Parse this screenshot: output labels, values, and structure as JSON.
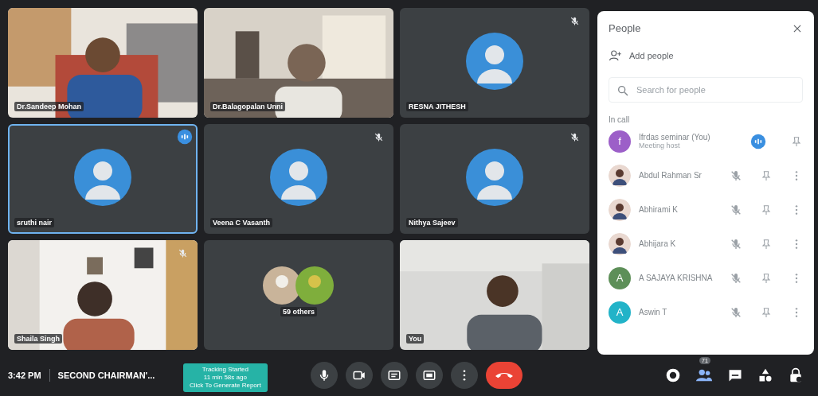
{
  "tiles": [
    {
      "name": "Dr.Sandeep Mohan",
      "kind": "video",
      "muted": false,
      "speaking": false
    },
    {
      "name": "Dr.Balagopalan Unni",
      "kind": "video",
      "muted": false,
      "speaking": false
    },
    {
      "name": "RESNA JITHESH",
      "kind": "avatar",
      "muted": true,
      "speaking": false
    },
    {
      "name": "sruthi nair",
      "kind": "avatar",
      "muted": false,
      "speaking": true
    },
    {
      "name": "Veena C Vasanth",
      "kind": "avatar",
      "muted": true,
      "speaking": false
    },
    {
      "name": "Nithya Sajeev",
      "kind": "avatar",
      "muted": true,
      "speaking": false
    },
    {
      "name": "Shaila Singh",
      "kind": "video",
      "muted": true,
      "speaking": false
    },
    {
      "name": "59 others",
      "kind": "others",
      "muted": false,
      "speaking": false
    },
    {
      "name": "You",
      "kind": "video",
      "muted": false,
      "speaking": false
    }
  ],
  "people": {
    "title": "People",
    "add": "Add people",
    "search": {
      "placeholder": "Search for people"
    },
    "section": "In call",
    "rows": [
      {
        "name": "Ifrdas seminar (You)",
        "subtitle": "Meeting host",
        "kind": "letter",
        "initial": "f",
        "color": "#9c5fc8",
        "speaking": true
      },
      {
        "name": "Abdul Rahman Sr",
        "speaking": false
      },
      {
        "name": "Abhirami K",
        "speaking": false
      },
      {
        "name": "Abhijara K",
        "speaking": false
      },
      {
        "name": "A SAJAYA KRISHNA",
        "kind": "letter",
        "initial": "A",
        "color": "#5d8f58",
        "speaking": false
      },
      {
        "name": "Aswin T",
        "kind": "letter",
        "initial": "A",
        "color": "#22b3c8",
        "speaking": false
      }
    ]
  },
  "bottom_bar": {
    "time": "3:42 PM",
    "meeting": "SECOND CHAIRMAN'...",
    "tracking": [
      "Tracking Started",
      "11 min 58s ago",
      "Click To Generate Report"
    ],
    "people_count": "71"
  }
}
